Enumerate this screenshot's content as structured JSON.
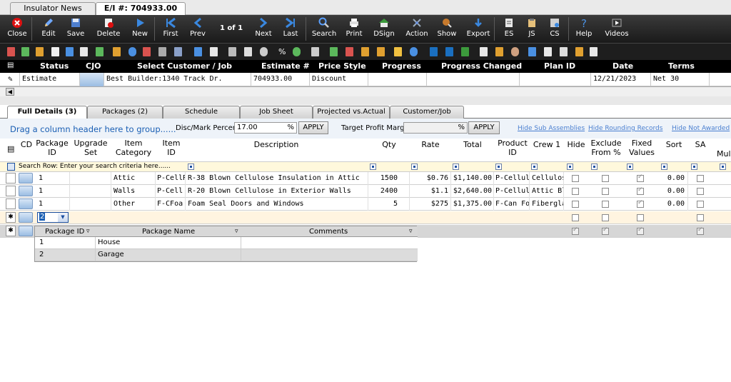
{
  "doc_tabs": [
    "Insulator News",
    "E/I #: 704933.00"
  ],
  "toolbar": {
    "close": "Close",
    "edit": "Edit",
    "save": "Save",
    "delete": "Delete",
    "new": "New",
    "first": "First",
    "prev": "Prev",
    "page_indicator": "1 of 1",
    "next": "Next",
    "last": "Last",
    "search": "Search",
    "print": "Print",
    "dsign": "DSign",
    "action": "Action",
    "show": "Show",
    "export": "Export",
    "es": "ES",
    "js": "JS",
    "cs": "CS",
    "help": "Help",
    "videos": "Videos"
  },
  "header_grid": {
    "columns": [
      "Status",
      "CJO",
      "Select Customer / Job",
      "Estimate #",
      "Price Style",
      "Progress",
      "Progress Changed",
      "Plan ID",
      "Date",
      "Terms"
    ],
    "row": {
      "status": "Estimate",
      "cjo": "",
      "customer": "Best Builder:1340 Track Dr.",
      "estimate_no": "704933.00",
      "price_style": "Discount",
      "progress": "",
      "progress_changed": "",
      "plan_id": "",
      "date": "12/21/2023",
      "terms": "Net 30"
    }
  },
  "sub_tabs": [
    "Full Details (3)",
    "Packages (2)",
    "Schedule",
    "Job Sheet",
    "Projected vs.Actual",
    "Customer/Job"
  ],
  "group_bar": {
    "drag_hint": "Drag a column header here to group......",
    "disc_label": "Disc/Mark Percent:",
    "disc_value": "17.00",
    "disc_unit": "%",
    "apply1": "APPLY",
    "target_label": "Target Profit Margin:",
    "target_value": "",
    "target_unit": "%",
    "apply2": "APPLY",
    "link_sub": "Hide Sub Assemblies",
    "link_round": "Hide Rounding Records",
    "link_notawarded": "Hide Not Awarded"
  },
  "detail_columns": {
    "cd": "CD",
    "package_id": "Package ID",
    "upgrade_set": "Upgrade Set",
    "item_category": "Item Category",
    "item_id": "Item ID",
    "description": "Description",
    "qty": "Qty",
    "rate": "Rate",
    "total": "Total",
    "product_id": "Product ID",
    "crew1": "Crew 1",
    "hide": "Hide",
    "exclude_from": "Exclude From %",
    "fixed_values": "Fixed Values",
    "sort": "Sort",
    "sa": "SA",
    "mul": "Mul"
  },
  "search_row_text": "Search Row: Enter your search criteria here......",
  "detail_rows": [
    {
      "package_id": "1",
      "upgrade_set": "",
      "category": "Attic",
      "item_id": "P-CellR",
      "description": "R-38 Blown Cellulose Insulation in Attic",
      "qty": "1500",
      "rate": "$0.76",
      "total": "$1,140.00",
      "product_id": "P-Cellulo",
      "crew1": "Cellulose",
      "hide": false,
      "exclude": false,
      "fixed": true,
      "sort": "0.00",
      "sa": false
    },
    {
      "package_id": "1",
      "upgrade_set": "",
      "category": "Walls",
      "item_id": "P-Cell",
      "description": "R-20 Blown Cellulose in Exterior Walls",
      "qty": "2400",
      "rate": "$1.1",
      "total": "$2,640.00",
      "product_id": "P-Cellulo",
      "crew1": "Attic Blo",
      "hide": false,
      "exclude": false,
      "fixed": true,
      "sort": "0.00",
      "sa": false
    },
    {
      "package_id": "1",
      "upgrade_set": "",
      "category": "Other",
      "item_id": "F-CFoa",
      "description": "Foam Seal Doors and Windows",
      "qty": "5",
      "rate": "$275",
      "total": "$1,375.00",
      "product_id": "F-Can Fo",
      "crew1": "Fiberglas",
      "hide": false,
      "exclude": false,
      "fixed": true,
      "sort": "0.00",
      "sa": false
    }
  ],
  "new_row": {
    "package_value": "2"
  },
  "package_dropdown": {
    "headers": [
      "Package ID",
      "Package Name",
      "Comments"
    ],
    "rows": [
      {
        "id": "1",
        "name": "House",
        "comments": ""
      },
      {
        "id": "2",
        "name": "Garage",
        "comments": ""
      }
    ]
  },
  "colors": {
    "accent_blue": "#1a5fb4",
    "ribbon_bg": "#252525",
    "search_row": "#fff8dc"
  }
}
